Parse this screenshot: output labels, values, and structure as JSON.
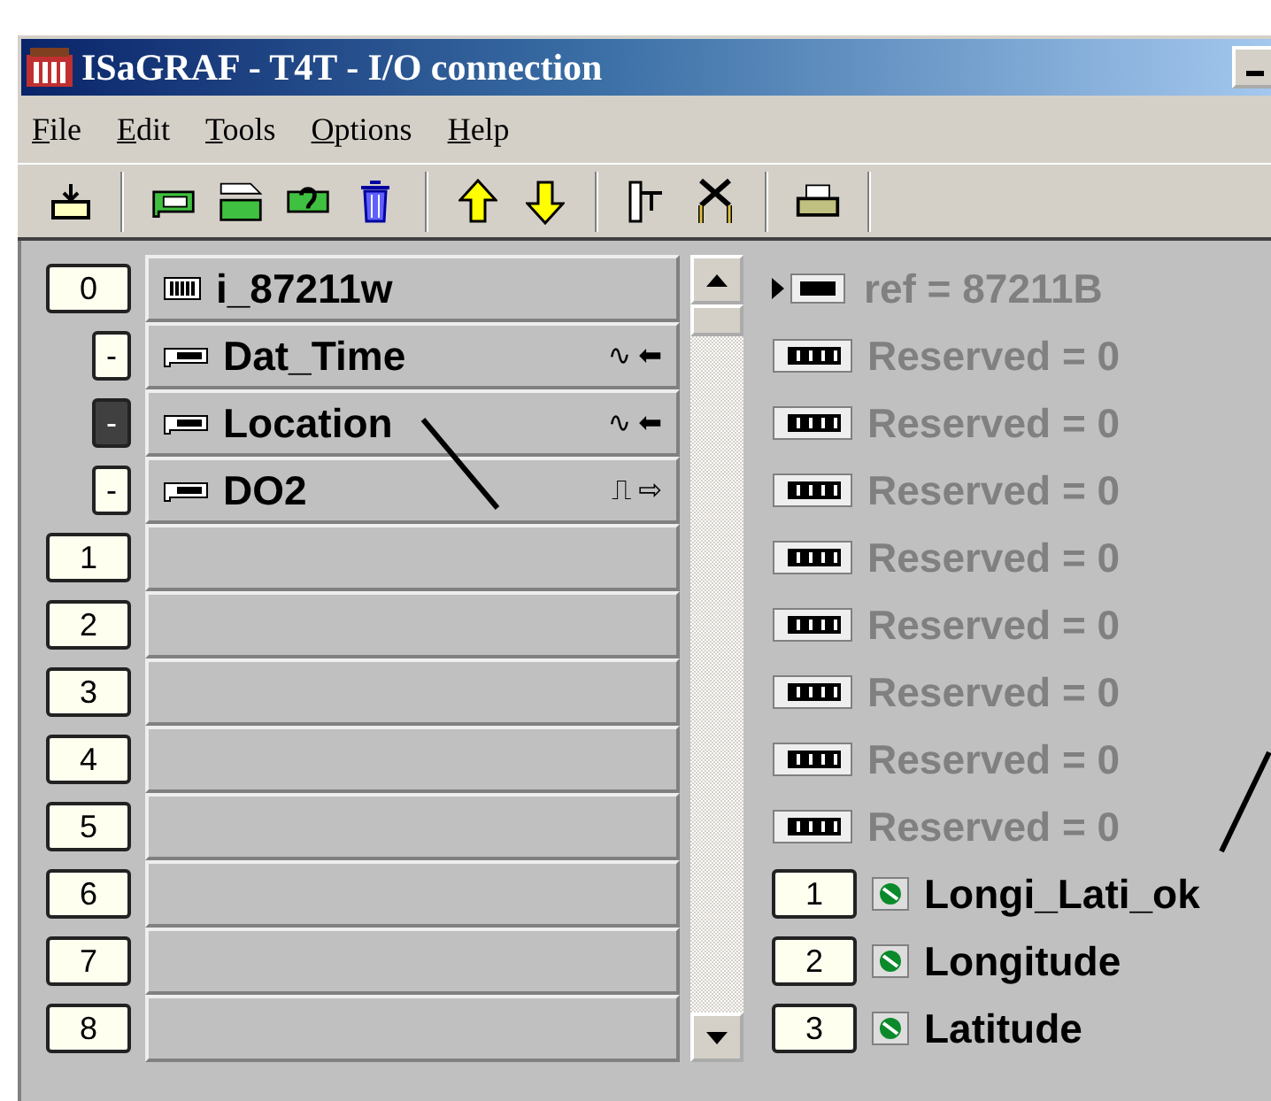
{
  "window": {
    "title": "ISaGRAF - T4T - I/O connection"
  },
  "menu": [
    "File",
    "Edit",
    "Tools",
    "Options",
    "Help"
  ],
  "slots": [
    {
      "kind": "board",
      "label": "0",
      "name": "i_87211w",
      "selected": false
    },
    {
      "kind": "channel",
      "label": "-",
      "name": "Dat_Time",
      "selected": false,
      "signal": "∿",
      "direction": "⬅"
    },
    {
      "kind": "channel",
      "label": "-",
      "name": "Location",
      "selected": true,
      "signal": "∿",
      "direction": "⬅"
    },
    {
      "kind": "channel",
      "label": "-",
      "name": "DO2",
      "selected": false,
      "signal": "⎍",
      "direction": "⇨"
    },
    {
      "kind": "empty",
      "label": "1",
      "selected": false
    },
    {
      "kind": "empty",
      "label": "2",
      "selected": false
    },
    {
      "kind": "empty",
      "label": "3",
      "selected": false
    },
    {
      "kind": "empty",
      "label": "4",
      "selected": false
    },
    {
      "kind": "empty",
      "label": "5",
      "selected": false
    },
    {
      "kind": "empty",
      "label": "6",
      "selected": false
    },
    {
      "kind": "empty",
      "label": "7",
      "selected": false
    },
    {
      "kind": "empty",
      "label": "8",
      "selected": false
    }
  ],
  "params": [
    {
      "kind": "ref",
      "text": "ref = 87211B"
    },
    {
      "kind": "reserved",
      "text": "Reserved = 0"
    },
    {
      "kind": "reserved",
      "text": "Reserved = 0"
    },
    {
      "kind": "reserved",
      "text": "Reserved = 0"
    },
    {
      "kind": "reserved",
      "text": "Reserved = 0"
    },
    {
      "kind": "reserved",
      "text": "Reserved = 0"
    },
    {
      "kind": "reserved",
      "text": "Reserved = 0"
    },
    {
      "kind": "reserved",
      "text": "Reserved = 0"
    },
    {
      "kind": "reserved",
      "text": "Reserved = 0"
    },
    {
      "kind": "variable",
      "index": "1",
      "text": "Longi_Lati_ok"
    },
    {
      "kind": "variable",
      "index": "2",
      "text": "Longitude"
    },
    {
      "kind": "variable",
      "index": "3",
      "text": "Latitude"
    }
  ]
}
